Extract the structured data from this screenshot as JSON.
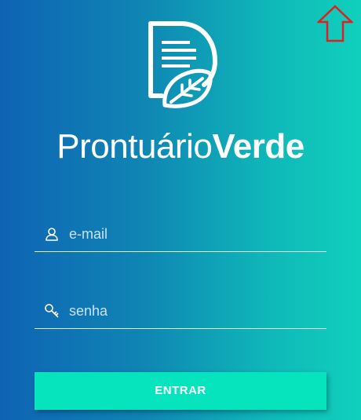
{
  "brand": {
    "name_light": "Prontuário",
    "name_bold": "Verde"
  },
  "login": {
    "email": {
      "placeholder": "e-mail",
      "value": "",
      "icon": "user-icon"
    },
    "password": {
      "placeholder": "senha",
      "value": "",
      "icon": "key-icon"
    },
    "submit_label": "ENTRAR"
  },
  "overlay": {
    "icon": "up-arrow-icon",
    "color": "#e02020"
  },
  "colors": {
    "gradient_start": "#0f63b4",
    "gradient_end": "#10d0bc",
    "button": "#06e4bd"
  }
}
